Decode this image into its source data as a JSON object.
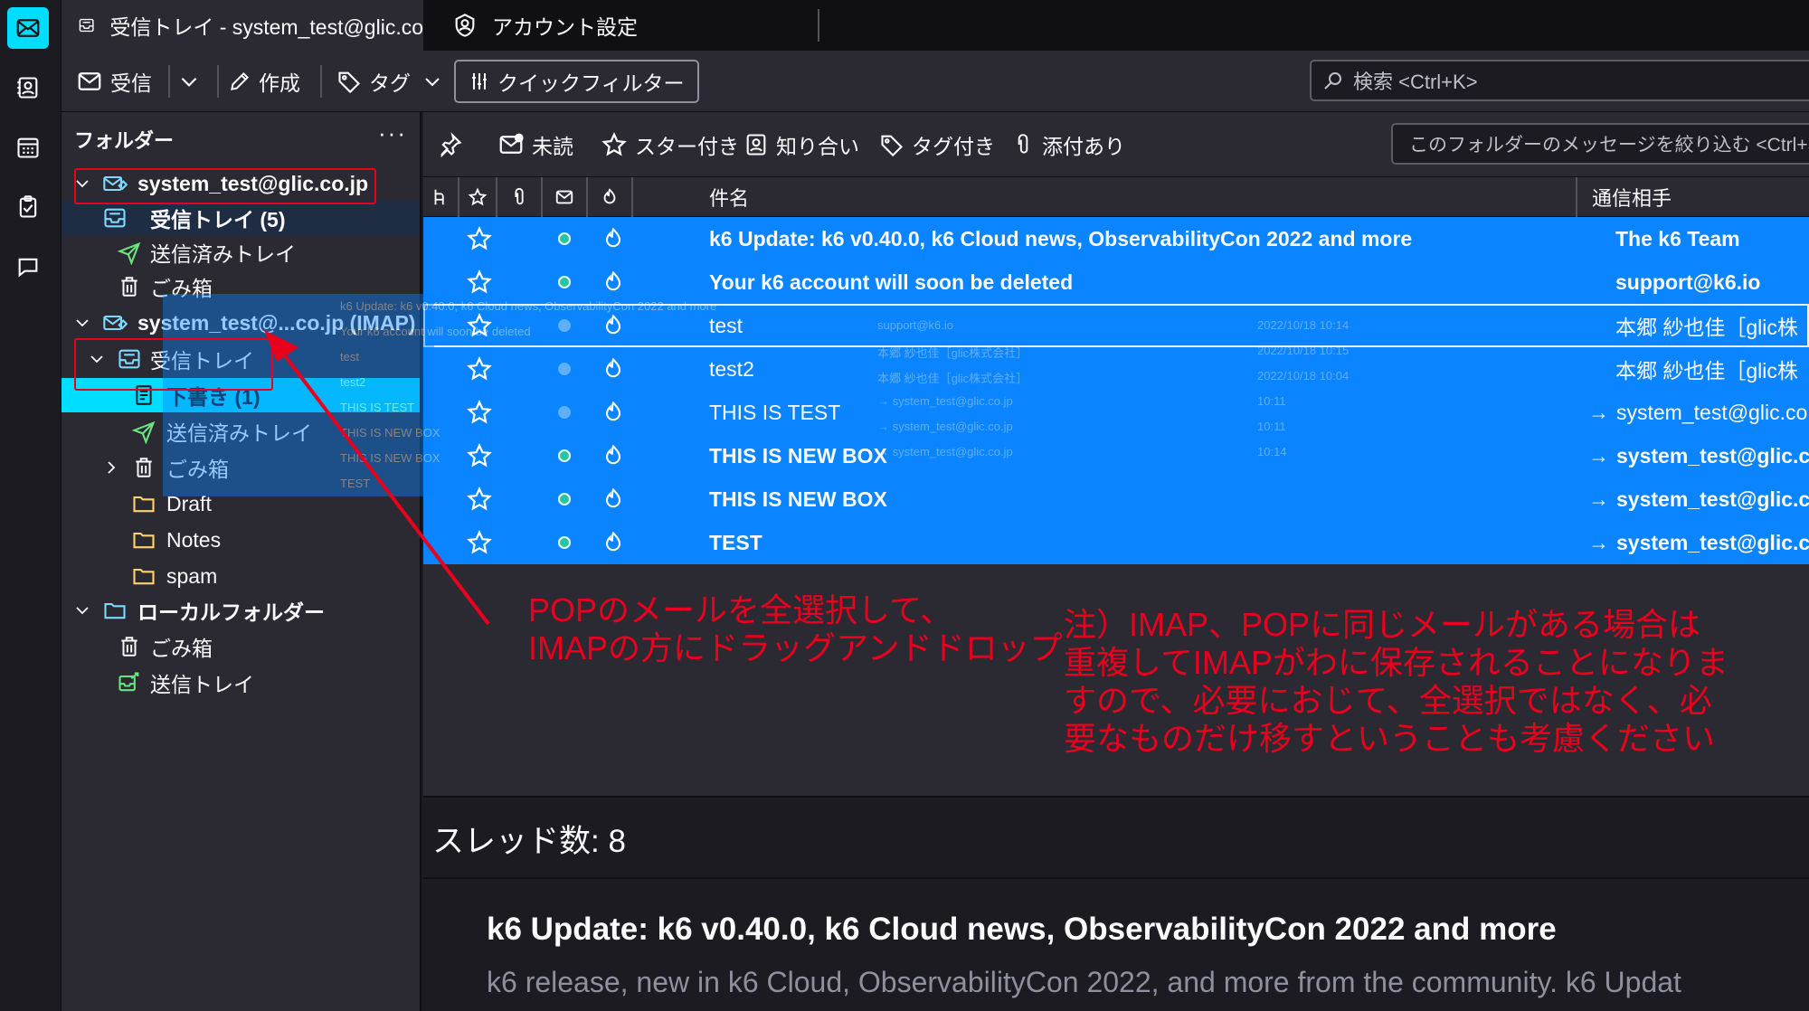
{
  "tabs": [
    {
      "label": "受信トレイ - system_test@glic.co"
    },
    {
      "label": "アカウント設定"
    }
  ],
  "toolbar": {
    "get_messages": "受信",
    "write": "作成",
    "tag": "タグ",
    "quick_filter": "クイックフィルター",
    "search_placeholder": "検索 <Ctrl+K>"
  },
  "folder_pane": {
    "header": "フォルダー",
    "menu": "···",
    "folders": [
      {
        "label": "system_test@glic.co.jp"
      },
      {
        "label": "受信トレイ (5)"
      },
      {
        "label": "送信済みトレイ"
      },
      {
        "label": "ごみ箱"
      },
      {
        "label": "system_test@...co.jp (IMAP)"
      },
      {
        "label": "受信トレイ"
      },
      {
        "label": "下書き (1)"
      },
      {
        "label": "送信済みトレイ"
      },
      {
        "label": "ごみ箱"
      },
      {
        "label": "Draft"
      },
      {
        "label": "Notes"
      },
      {
        "label": "spam"
      },
      {
        "label": "ローカルフォルダー"
      },
      {
        "label": "ごみ箱"
      },
      {
        "label": "送信トレイ"
      }
    ]
  },
  "quick_filter_bar": {
    "unread": "未読",
    "starred": "スター付き",
    "contacts": "知り合い",
    "tags": "タグ付き",
    "attachments": "添付あり",
    "search_placeholder": "このフォルダーのメッセージを絞り込む <Ctrl+S"
  },
  "thread_columns": {
    "subject": "件名",
    "correspondent": "通信相手"
  },
  "messages": [
    {
      "subject": "k6 Update: k6 v0.40.0, k6 Cloud news, ObservabilityCon 2022 and more",
      "correspondent": "The k6 Team",
      "unread": true,
      "outgoing": false
    },
    {
      "subject": "Your k6 account will soon be deleted",
      "correspondent": "support@k6.io",
      "unread": true,
      "outgoing": false
    },
    {
      "subject": "test",
      "correspondent": "本郷 紗也佳［glic株",
      "unread": false,
      "outgoing": false
    },
    {
      "subject": "test2",
      "correspondent": "本郷 紗也佳［glic株",
      "unread": false,
      "outgoing": false
    },
    {
      "subject": "THIS IS TEST",
      "correspondent": "system_test@glic.co",
      "unread": false,
      "outgoing": true
    },
    {
      "subject": "THIS IS NEW BOX",
      "correspondent": "system_test@glic.co",
      "unread": true,
      "outgoing": true
    },
    {
      "subject": "THIS IS NEW BOX",
      "correspondent": "system_test@glic.co",
      "unread": true,
      "outgoing": true
    },
    {
      "subject": "TEST",
      "correspondent": "system_test@glic.co",
      "unread": true,
      "outgoing": true
    }
  ],
  "drag_ghost": {
    "rows": [
      "k6 Update: k6 v0.40.0, k6 Cloud news, ObservabilityCon 2022 and more",
      "Your k6 account will soon be deleted",
      "test",
      "test2",
      "THIS IS TEST",
      "THIS IS NEW BOX",
      "THIS IS NEW BOX",
      "TEST"
    ],
    "senders": [
      "support@k6.io",
      "本郷 紗也佳［glic株式会社］",
      "本郷 紗也佳［glic株式会社］",
      "→ system_test@glic.co.jp",
      "→ system_test@glic.co.jp",
      "→ system_test@glic.co.jp"
    ],
    "dates": [
      "2022/10/18 10:14",
      "2022/10/18 10:15",
      "2022/10/18 10:04",
      "10:11",
      "10:11",
      "10:14"
    ]
  },
  "message_pane": {
    "thread_count": "スレッド数: 8",
    "preview_title": "k6 Update: k6 v0.40.0, k6 Cloud news, ObservabilityCon 2022 and more",
    "preview_body": "k6 release, new in k6 Cloud, ObservabilityCon 2022, and more from the community. k6 Updat"
  },
  "annotations": {
    "instruction": "POPのメールを全選択して、\nIMAPの方にドラッグアンドドロップ",
    "note": "注）IMAP、POPに同じメールがある場合は\n重複してIMAPがわに保存されることになりま\nすので、必要におじて、全選択ではなく、必\n要なものだけ移すということも考慮ください"
  },
  "colors": {
    "accent": "#00ddff",
    "selection": "#0a84ff",
    "annotation": "#e8001c",
    "unread_dot": "#2ac3a2",
    "background": "#1c1b22",
    "pane": "#2b2a33"
  },
  "icons": [
    "mail-icon",
    "address-book-icon",
    "calendar-icon",
    "tasks-icon",
    "chat-icon",
    "inbox-icon",
    "account-settings-icon",
    "close-icon",
    "get-messages-icon",
    "chevron-down-icon",
    "pencil-icon",
    "tag-icon",
    "filter-icon",
    "search-icon",
    "pin-icon",
    "unread-icon",
    "star-icon",
    "contact-icon",
    "attachment-icon",
    "thread-icon",
    "junk-icon",
    "sent-icon",
    "trash-icon",
    "folder-icon",
    "drafts-icon",
    "outbox-icon"
  ]
}
